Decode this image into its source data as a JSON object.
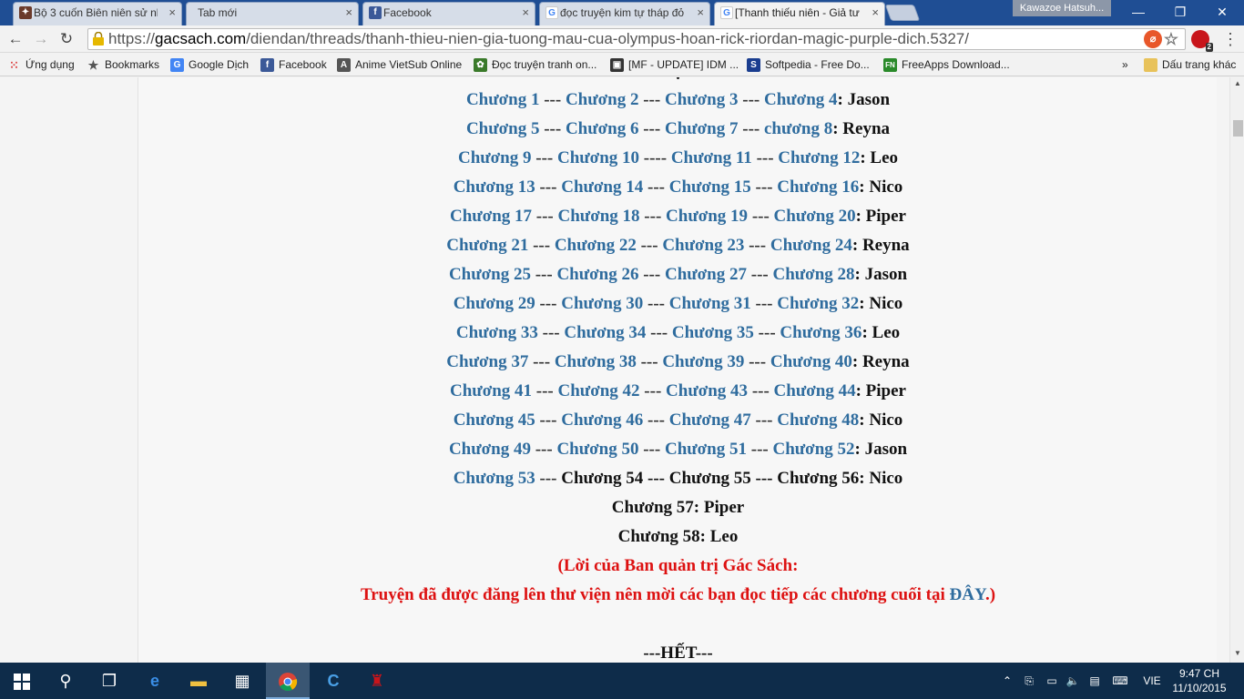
{
  "tabs": [
    {
      "title": "Bộ 3 cuốn Biên niên sử nh",
      "icon": "app-icon",
      "active": false
    },
    {
      "title": "Tab mới",
      "icon": "",
      "active": false
    },
    {
      "title": "Facebook",
      "icon": "facebook-icon",
      "active": false
    },
    {
      "title": "đọc truyện kim tự tháp đỏ",
      "icon": "google-icon",
      "active": false
    },
    {
      "title": "[Thanh thiếu niên - Giả tư",
      "icon": "google-icon",
      "active": true
    }
  ],
  "profile": {
    "name": "Kawazoe Hatsuh..."
  },
  "window_controls": {
    "minimize": "—",
    "restore": "❐",
    "close": "✕"
  },
  "toolbar": {
    "url_prefix": "https://",
    "url_host": "gacsach.com",
    "url_path": "/diendan/threads/thanh-thieu-nien-gia-tuong-mau-cua-olympus-hoan-rick-riordan-magic-purple-dich.5327/",
    "ext_badge": "2"
  },
  "bookmarks": [
    {
      "label": "Ứng dụng",
      "icon": "apps-icon"
    },
    {
      "label": "Bookmarks",
      "icon": "star-icon"
    },
    {
      "label": "Google Dịch",
      "icon": "google-translate-icon"
    },
    {
      "label": "Facebook",
      "icon": "facebook-icon"
    },
    {
      "label": "Anime VietSub Online",
      "icon": "anime-icon"
    },
    {
      "label": "Đọc truyện tranh on...",
      "icon": "manga-icon"
    },
    {
      "label": "[MF - UPDATE] IDM ...",
      "icon": "idm-icon"
    },
    {
      "label": "Softpedia - Free Do...",
      "icon": "softpedia-icon"
    },
    {
      "label": "FreeApps Download...",
      "icon": "freeapps-icon"
    }
  ],
  "bookmarks_overflow": "»",
  "other_bookmarks": "Dấu trang khác",
  "chapters": [
    {
      "links": [
        "Chương 1",
        "Chương 2",
        "Chương 3",
        "Chương 4"
      ],
      "seps": [
        " --- ",
        " --- ",
        " --- "
      ],
      "plain": [],
      "tail": ": Jason"
    },
    {
      "links": [
        "Chương 5",
        "Chương 6",
        "Chương 7",
        "chương 8"
      ],
      "seps": [
        " --- ",
        " --- ",
        " --- "
      ],
      "plain": [],
      "tail": ": Reyna"
    },
    {
      "links": [
        "Chương 9",
        "Chương 10",
        "Chương 11",
        "Chương 12"
      ],
      "seps": [
        " --- ",
        " ---- ",
        " --- "
      ],
      "plain": [],
      "tail": ": Leo"
    },
    {
      "links": [
        "Chương 13",
        "Chương 14",
        "Chương 15",
        "Chương 16"
      ],
      "seps": [
        " --- ",
        " --- ",
        " --- "
      ],
      "plain": [],
      "tail": ": Nico"
    },
    {
      "links": [
        "Chương 17",
        "Chương 18",
        "Chương 19",
        "Chương 20"
      ],
      "seps": [
        " --- ",
        " --- ",
        " --- "
      ],
      "plain": [],
      "tail": ": Piper"
    },
    {
      "links": [
        "Chương 21",
        "Chương 22",
        "Chương 23",
        "Chương 24"
      ],
      "seps": [
        " --- ",
        " --- ",
        " --- "
      ],
      "plain": [],
      "tail": ": Reyna"
    },
    {
      "links": [
        "Chương 25",
        "Chương 26",
        "Chương 27",
        "Chương 28"
      ],
      "seps": [
        " --- ",
        " --- ",
        " --- "
      ],
      "plain": [],
      "tail": ": Jason"
    },
    {
      "links": [
        "Chương 29",
        "Chương 30",
        "Chương 31",
        "Chương 32"
      ],
      "seps": [
        " --- ",
        " --- ",
        " --- "
      ],
      "plain": [],
      "tail": ": Nico"
    },
    {
      "links": [
        "Chương 33",
        "Chương 34",
        "Chương 35",
        "Chương 36"
      ],
      "seps": [
        " --- ",
        " --- ",
        " --- "
      ],
      "plain": [],
      "tail": ": Leo"
    },
    {
      "links": [
        "Chương 37",
        "Chương 38",
        "Chương 39",
        "Chương 40"
      ],
      "seps": [
        " --- ",
        " --- ",
        " --- "
      ],
      "plain": [],
      "tail": ": Reyna"
    },
    {
      "links": [
        "Chương 41",
        "Chương 42",
        "Chương 43",
        "Chương 44"
      ],
      "seps": [
        " --- ",
        " --- ",
        " --- "
      ],
      "plain": [],
      "tail": ": Piper"
    },
    {
      "links": [
        "Chương 45",
        "Chương 46",
        "Chương 47",
        "Chương 48"
      ],
      "seps": [
        " --- ",
        " --- ",
        " --- "
      ],
      "plain": [],
      "tail": ": Nico"
    },
    {
      "links": [
        "Chương 49",
        "Chương 50",
        "Chương 51",
        "Chương 52"
      ],
      "seps": [
        " --- ",
        " --- ",
        " --- "
      ],
      "plain": [],
      "tail": ": Jason"
    },
    {
      "links": [
        "Chương 53"
      ],
      "seps": [
        " --- "
      ],
      "plain": [
        "Chương 54 --- Chương 55 --- Chương 56"
      ],
      "tail": ": Nico"
    }
  ],
  "plain_lines": [
    "Chương 57: Piper",
    "Chương 58: Leo"
  ],
  "notice": {
    "line1": "(Lời của Ban quản trị Gác Sách:",
    "line2_before": "Truyện đã được đăng lên thư viện nên mời các bạn đọc tiếp các chương cuối tại ",
    "line2_link": "ĐÂY",
    "line2_after": ".)"
  },
  "end_text": "---HẾT---",
  "taskbar": {
    "language": "VIE",
    "time": "9:47 CH",
    "date": "11/10/2015"
  }
}
